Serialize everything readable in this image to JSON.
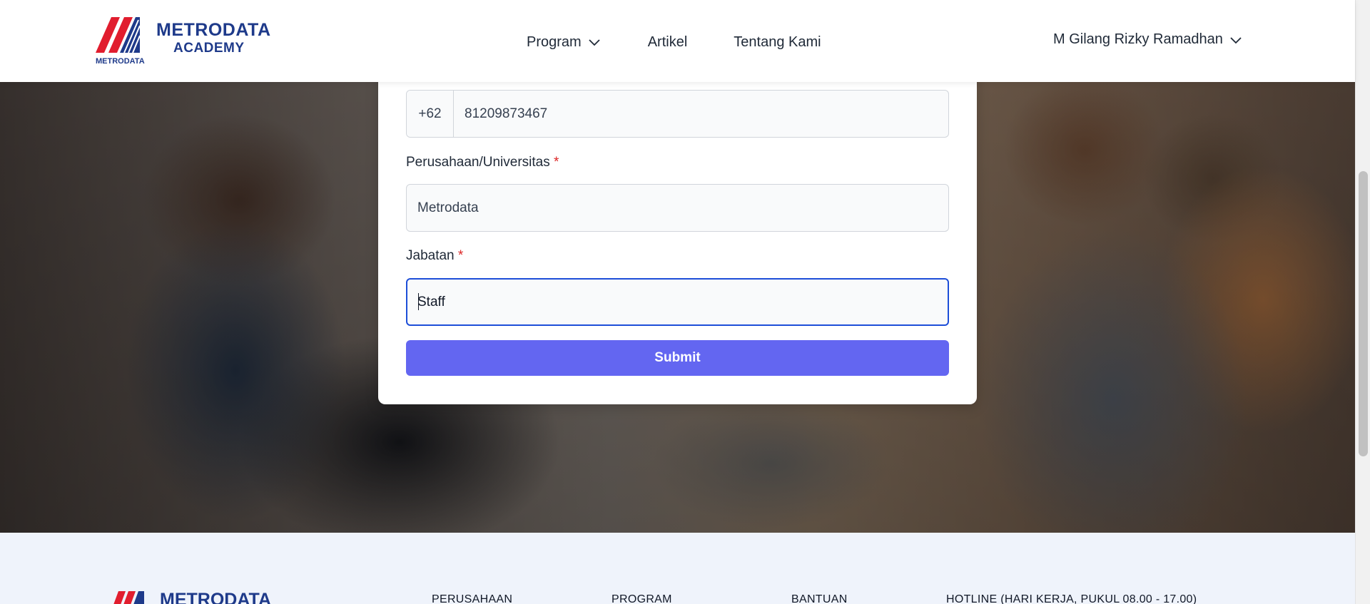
{
  "header": {
    "logo_main": "METRODATA",
    "logo_sub": "ACADEMY",
    "logo_under": "METRODATA",
    "nav": {
      "program": "Program",
      "artikel": "Artikel",
      "tentang": "Tentang Kami"
    },
    "user_name": "M Gilang Rizky Ramadhan"
  },
  "form": {
    "phone_prefix": "+62",
    "phone_value": "81209873467",
    "company_label": "Perusahaan/Universitas",
    "company_value": "Metrodata",
    "position_label": "Jabatan",
    "position_value": "Staff",
    "required_mark": "*",
    "submit_label": "Submit"
  },
  "footer": {
    "logo_text": "METRODATA",
    "col_perusahaan": "PERUSAHAAN",
    "col_program": "PROGRAM",
    "col_bantuan": "BANTUAN",
    "hotline": "HOTLINE (HARI KERJA, PUKUL 08.00 - 17.00)"
  },
  "colors": {
    "brand_blue": "#1e3a8a",
    "logo_red": "#e11d2e",
    "submit": "#6366f1",
    "focus_border": "#1d4ed8"
  },
  "icons": [
    "chevron-down-icon",
    "metrodata-logo"
  ]
}
